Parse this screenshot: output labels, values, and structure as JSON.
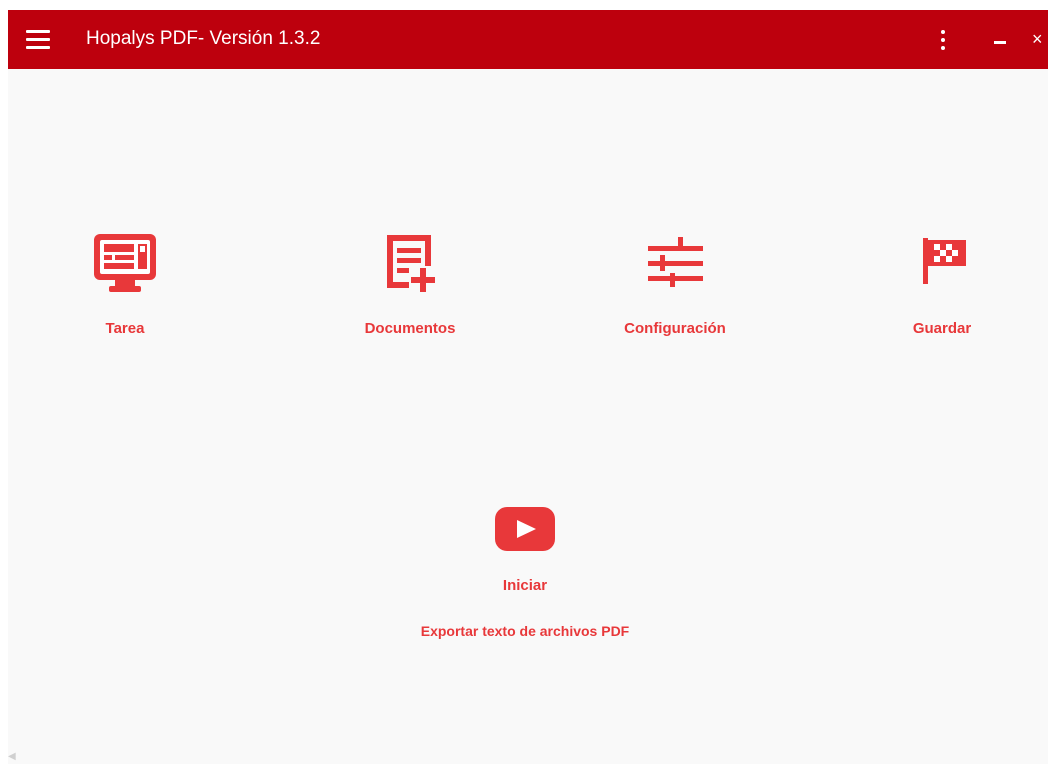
{
  "titlebar": {
    "title": "Hopalys PDF- Versión 1.3.2",
    "background": "#bd000d",
    "menu_icon": "hamburger-icon",
    "more_icon": "kebab-menu-icon",
    "minimize_icon": "minimize-icon",
    "close_label": "×"
  },
  "accent_color": "#e8383a",
  "tiles": [
    {
      "label": "Tarea",
      "icon": "monitor-icon"
    },
    {
      "label": "Documentos",
      "icon": "document-add-icon"
    },
    {
      "label": "Configuración",
      "icon": "sliders-icon"
    },
    {
      "label": "Guardar",
      "icon": "checkered-flag-icon"
    }
  ],
  "start": {
    "label": "Iniciar",
    "icon": "play-button-icon",
    "description": "Exportar texto de archivos PDF"
  }
}
